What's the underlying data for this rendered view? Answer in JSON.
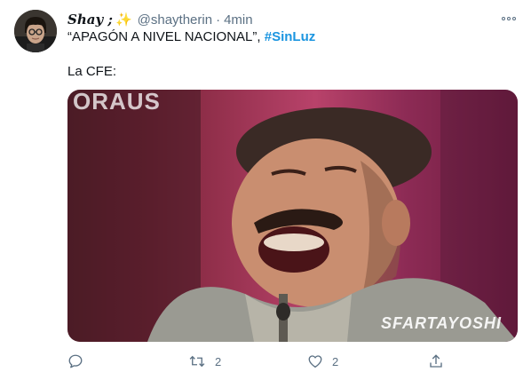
{
  "tweet": {
    "display_name": "Shay ;",
    "name_emoji": "✨",
    "handle": "@shaytherin",
    "separator": "·",
    "time": "4min",
    "text_quote": "“APAGÓN A NIVEL NACIONAL”, ",
    "hashtag": "#SinLuz",
    "text_line2": "La CFE:"
  },
  "media": {
    "top_overlay_text": "ORAUS",
    "watermark": "SFARTAYOSHI"
  },
  "actions": {
    "retweet_count": "2",
    "like_count": "2"
  },
  "icons": [
    "reply-icon",
    "retweet-icon",
    "like-icon",
    "share-icon",
    "more-options-icon"
  ],
  "colors": {
    "hashtag": "#1b95e0",
    "secondary_text": "#5b7083",
    "sparkle": "#f4b400"
  }
}
